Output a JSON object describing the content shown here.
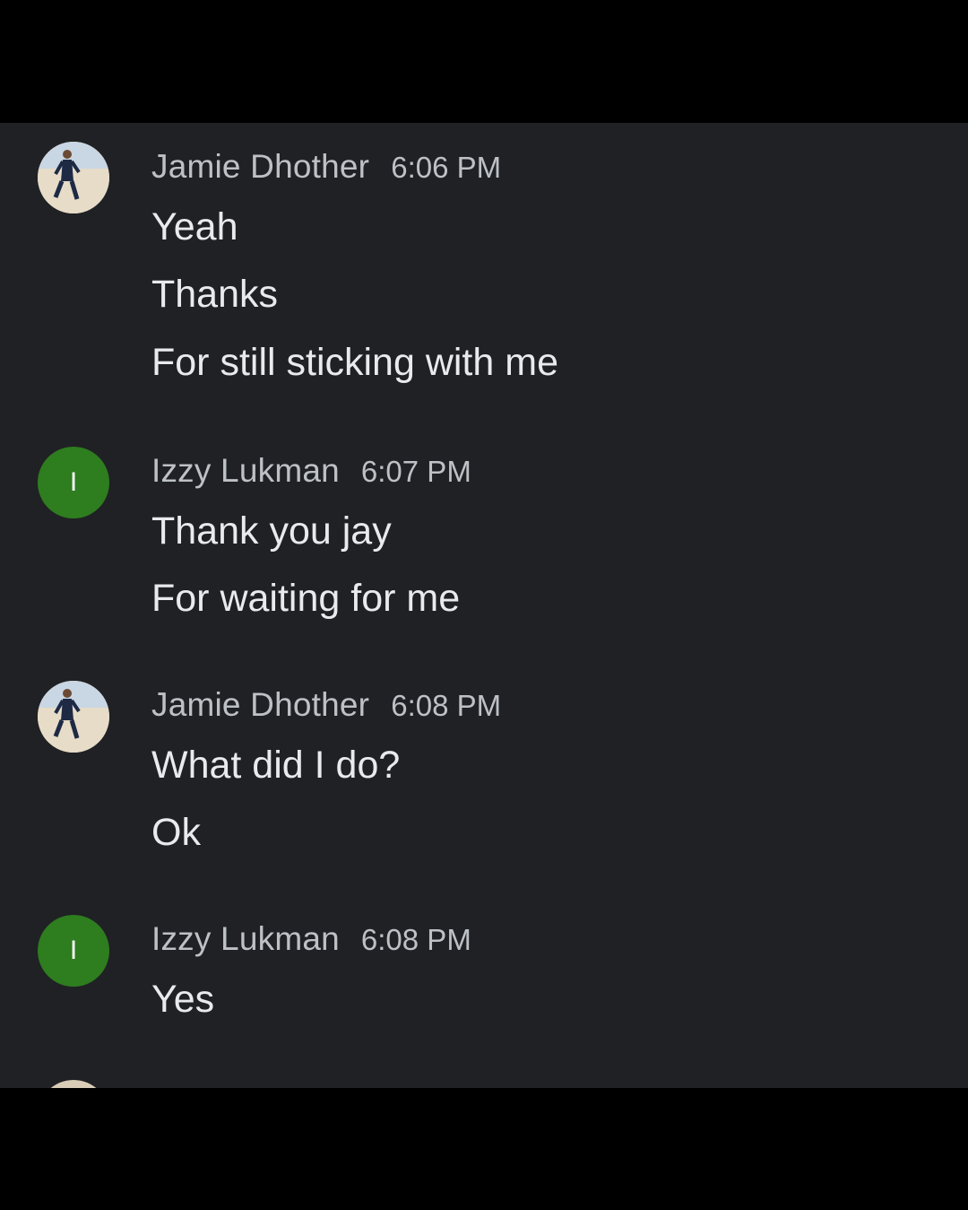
{
  "groups": [
    {
      "sender": "Jamie Dhother",
      "time": "6:06 PM",
      "avatar": {
        "type": "photo",
        "icon": "user-photo-avatar"
      },
      "messages": [
        "Yeah",
        "Thanks",
        "For still sticking with me"
      ]
    },
    {
      "sender": "Izzy Lukman",
      "time": "6:07 PM",
      "avatar": {
        "type": "letter",
        "letter": "I",
        "color": "#2e7d1f"
      },
      "messages": [
        "Thank you jay",
        "For waiting for me"
      ]
    },
    {
      "sender": "Jamie Dhother",
      "time": "6:08 PM",
      "avatar": {
        "type": "photo",
        "icon": "user-photo-avatar"
      },
      "messages": [
        "What did I do?",
        "Ok"
      ]
    },
    {
      "sender": "Izzy Lukman",
      "time": "6:08 PM",
      "avatar": {
        "type": "letter",
        "letter": "I",
        "color": "#2e7d1f"
      },
      "messages": [
        "Yes"
      ]
    }
  ],
  "colors": {
    "background": "#202124",
    "frame": "#000000",
    "sender_text": "#bdc1c6",
    "message_text": "#e8eaed",
    "letter_avatar": "#2e7d1f"
  }
}
